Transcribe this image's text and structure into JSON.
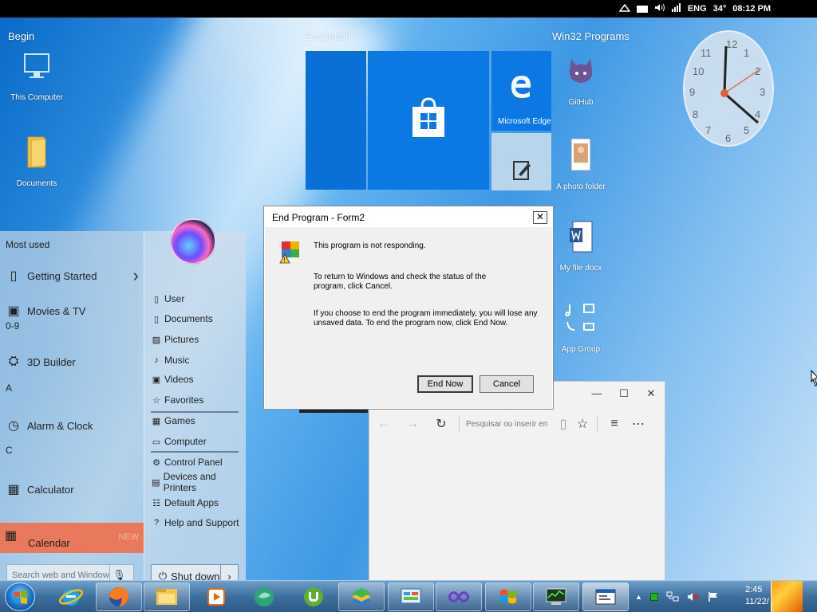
{
  "statusbar": {
    "lang": "ENG",
    "temp": "34°",
    "time": "08:12 PM",
    "icons": [
      "wifi-icon",
      "battery-icon",
      "volume-icon",
      "signal-icon",
      "weather-icon"
    ]
  },
  "sections": {
    "begin": "Begin",
    "essential": "Essential",
    "win32": "Win32 Programs"
  },
  "desktop_left": [
    {
      "label": "This Computer",
      "icon": "monitor-icon"
    },
    {
      "label": "Documents",
      "icon": "folder-icon"
    }
  ],
  "desktop_right": [
    {
      "label": "GitHub",
      "icon": "github-icon"
    },
    {
      "label": "A photo folder",
      "icon": "photo-folder-icon"
    },
    {
      "label": "My file docx",
      "icon": "word-doc-icon"
    },
    {
      "label": "App Group",
      "icon": "app-group-icon"
    }
  ],
  "tiles": {
    "edge": "Microsoft Edge"
  },
  "start_menu": {
    "most_used": "Most used",
    "items": [
      {
        "label": "Getting Started",
        "icon": "tablet-icon",
        "chevron": "›"
      },
      {
        "label": "Movies & TV",
        "icon": "film-icon"
      },
      {
        "label": "3D Builder",
        "icon": "3d-builder-icon"
      },
      {
        "label": "Alarm & Clock",
        "icon": "alarm-icon"
      },
      {
        "label": "Calculator",
        "icon": "calculator-icon"
      }
    ],
    "group_headers": {
      "numeric": "0-9",
      "a": "A",
      "c": "C"
    },
    "calendar": {
      "label": "Calendar",
      "badge": "NEW"
    },
    "search_placeholder": "Search web and Windows",
    "right_items": [
      {
        "label": "User",
        "icon": "user-icon"
      },
      {
        "label": "Documents",
        "icon": "document-icon"
      },
      {
        "label": "Pictures",
        "icon": "pictures-icon"
      },
      {
        "label": "Music",
        "icon": "music-icon"
      },
      {
        "label": "Videos",
        "icon": "video-icon"
      },
      {
        "label": "Favorites",
        "icon": "star-icon"
      },
      {
        "label": "Games",
        "icon": "games-icon"
      },
      {
        "label": "Computer",
        "icon": "computer-icon"
      },
      {
        "label": "Control Panel",
        "icon": "control-panel-icon"
      },
      {
        "label": "Devices and Printers",
        "icon": "printer-icon"
      },
      {
        "label": "Default Apps",
        "icon": "default-apps-icon"
      },
      {
        "label": "Help and Support",
        "icon": "help-icon"
      }
    ],
    "shutdown": "Shut down"
  },
  "dialog": {
    "title": "End Program - Form2",
    "line1": "This program is not responding.",
    "line2": "To return to Windows and check the status of the program, click Cancel.",
    "line3": "If you choose to end the program immediately, you will lose any unsaved data. To end the program now, click End Now.",
    "end_now": "End Now",
    "cancel": "Cancel",
    "close": "✕"
  },
  "edge": {
    "address_placeholder": "Pesquisar ou inserir en",
    "controls": [
      "—",
      "☐",
      "✕"
    ]
  },
  "taskbar": {
    "time": "2:45",
    "date": "11/22/",
    "apps": [
      "internet-explorer-icon",
      "firefox-icon",
      "file-explorer-icon",
      "media-player-icon",
      "camtasia-icon",
      "utorrent-icon",
      "bluestacks-icon",
      "control-panel-icon",
      "visual-studio-icon",
      "windows-flag-icon",
      "task-manager-icon",
      "form-window-icon"
    ]
  },
  "colors": {
    "accent": "#0b78e3",
    "highlight": "#e8795c",
    "taskbar": "#3f6f9e"
  }
}
